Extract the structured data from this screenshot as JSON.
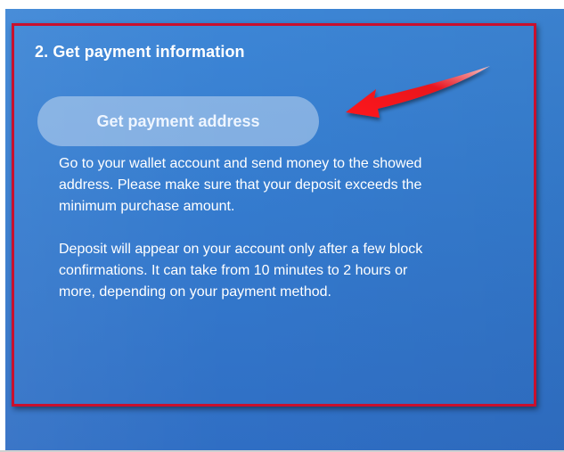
{
  "section": {
    "heading": "2. Get payment information",
    "button_label": "Get payment address",
    "paragraphs": [
      "Go to your wallet account and send money to the showed\naddress. Please make sure that your deposit exceeds the\nminimum purchase amount.",
      "Deposit will appear on your account only after a few block\nconfirmations. It can take from 10 minutes to 2 hours or\nmore, depending on your payment method."
    ]
  },
  "annotation": {
    "arrow_icon": "red-arrow-icon",
    "frame_color": "#c8102e",
    "arrow_color": "#e8131f"
  },
  "colors": {
    "panel_blue": "#357ccf",
    "text": "#ffffff"
  }
}
